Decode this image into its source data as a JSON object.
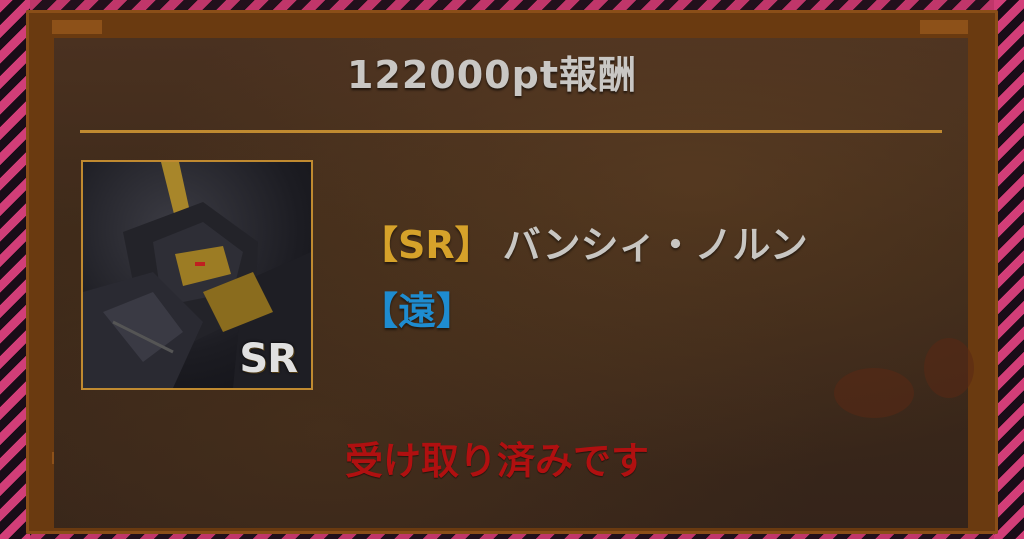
{
  "reward": {
    "title": "122000pt報酬",
    "rarity_tag": "【SR】",
    "unit_name": "バンシィ・ノルン",
    "range_tag": "【遠】",
    "rarity_badge": "SR",
    "status": "受け取り済みです"
  },
  "colors": {
    "frame_orange": "#6a3a10",
    "gold_accent": "#c08a30",
    "rarity_gold": "#d6a22a",
    "range_blue": "#1e8cd0",
    "status_red": "#b01010",
    "stripe_pink": "#d23e78"
  },
  "icons": {
    "unit_portrait": "mobile-suit-portrait-icon"
  }
}
